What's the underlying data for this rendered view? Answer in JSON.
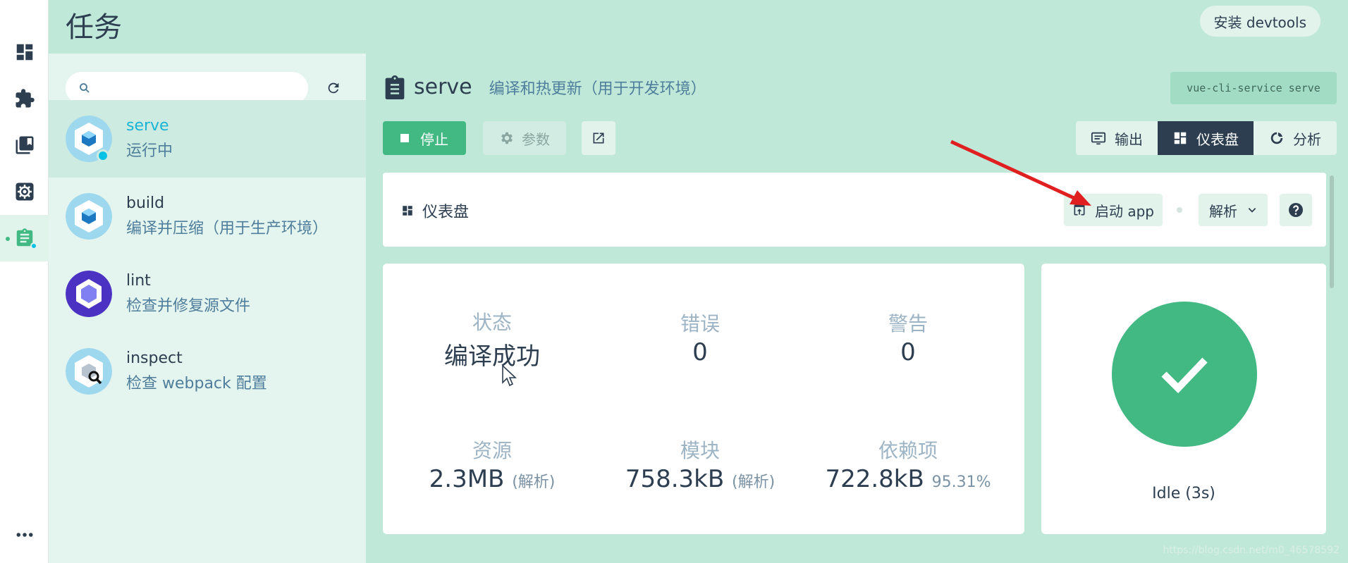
{
  "app": {
    "page_title": "任务",
    "devtools_label": "安装 devtools"
  },
  "rail": {
    "items": [
      {
        "icon": "dashboard-icon"
      },
      {
        "icon": "plugin-icon"
      },
      {
        "icon": "dependencies-icon"
      },
      {
        "icon": "config-icon"
      },
      {
        "icon": "tasks-icon",
        "active": true
      }
    ],
    "more_icon": "more-icon"
  },
  "search": {
    "placeholder": "",
    "value": ""
  },
  "tasks": [
    {
      "name": "serve",
      "desc": "运行中",
      "selected": true,
      "running": true
    },
    {
      "name": "build",
      "desc": "编译并压缩（用于生产环境）"
    },
    {
      "name": "lint",
      "desc": "检查并修复源文件"
    },
    {
      "name": "inspect",
      "desc": "检查 webpack 配置"
    }
  ],
  "task_detail": {
    "name": "serve",
    "desc": "编译和热更新（用于开发环境）",
    "command": "vue-cli-service serve",
    "stop_label": "停止",
    "params_label": "参数",
    "tabs": [
      {
        "label": "输出",
        "icon": "output-icon"
      },
      {
        "label": "仪表盘",
        "icon": "dashboard-icon",
        "active": true
      },
      {
        "label": "分析",
        "icon": "analyze-icon"
      }
    ]
  },
  "dashboard": {
    "title": "仪表盘",
    "start_app_label": "启动 app",
    "parse_label": "解析",
    "stats": {
      "status": {
        "label": "状态",
        "value": "编译成功"
      },
      "errors": {
        "label": "错误",
        "value": "0"
      },
      "warnings": {
        "label": "警告",
        "value": "0"
      },
      "assets": {
        "label": "资源",
        "value": "2.3MB",
        "sub": "(解析)"
      },
      "modules": {
        "label": "模块",
        "value": "758.3kB",
        "sub": "(解析)"
      },
      "deps": {
        "label": "依赖项",
        "value": "722.8kB",
        "sub": "95.31%"
      }
    },
    "idle_text": "Idle (3s)"
  },
  "watermark": "https://blog.csdn.net/m0_46578592",
  "colors": {
    "accent": "#42b983",
    "dark": "#2c3e50",
    "header_bg": "#bfe8d8",
    "running": "#03c2e6",
    "arrow": "#e02020"
  }
}
